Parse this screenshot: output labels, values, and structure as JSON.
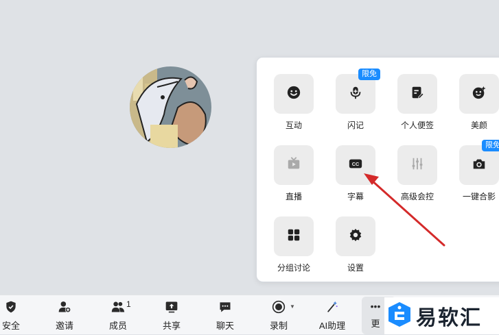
{
  "menu": {
    "items": [
      {
        "label": "互动",
        "icon": "smile-icon",
        "badge": ""
      },
      {
        "label": "闪记",
        "icon": "mic-ai-icon",
        "badge": "限免"
      },
      {
        "label": "个人便签",
        "icon": "note-edit-icon",
        "badge": ""
      },
      {
        "label": "美颜",
        "icon": "beauty-face-icon",
        "badge": ""
      },
      {
        "label": "直播",
        "icon": "tv-live-icon",
        "badge": ""
      },
      {
        "label": "字幕",
        "icon": "cc-subtitle-icon",
        "badge": ""
      },
      {
        "label": "高级会控",
        "icon": "sliders-icon",
        "badge": ""
      },
      {
        "label": "一键合影",
        "icon": "camera-icon",
        "badge": "限免"
      },
      {
        "label": "分组讨论",
        "icon": "grid-icon",
        "badge": ""
      },
      {
        "label": "设置",
        "icon": "gear-icon",
        "badge": ""
      }
    ]
  },
  "toolbar": {
    "items": [
      {
        "label": "安全",
        "icon": "shield-icon"
      },
      {
        "label": "邀请",
        "icon": "add-user-icon"
      },
      {
        "label": "成员",
        "icon": "members-icon",
        "count": "1"
      },
      {
        "label": "共享",
        "icon": "share-screen-icon"
      },
      {
        "label": "聊天",
        "icon": "chat-icon"
      },
      {
        "label": "录制",
        "icon": "record-icon"
      },
      {
        "label": "AI助理",
        "icon": "ai-wand-icon"
      },
      {
        "label": "更",
        "icon": "more-icon"
      }
    ]
  },
  "watermark": {
    "text": "易软汇"
  },
  "colors": {
    "accent": "#1a8cff",
    "arrow": "#d42a2a",
    "tile": "#ececec"
  }
}
